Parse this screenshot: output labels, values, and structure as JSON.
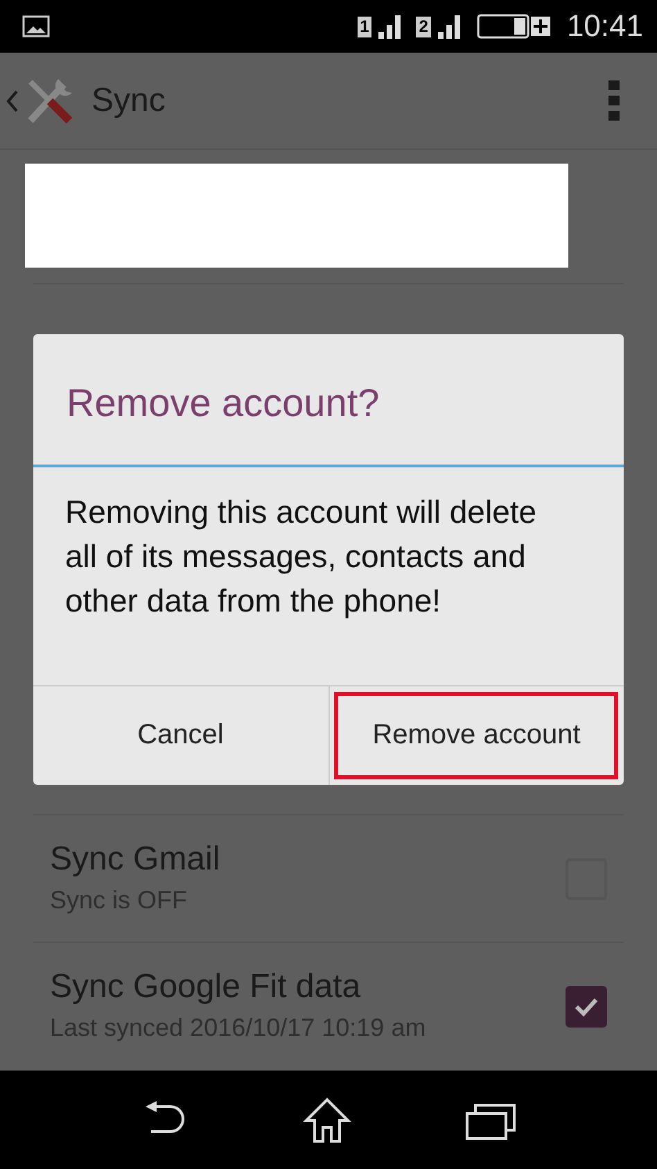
{
  "status_bar": {
    "time": "10:41",
    "sim_labels": [
      "1",
      "2"
    ]
  },
  "action_bar": {
    "title": "Sync"
  },
  "rows": [
    {
      "title": "Sync Gmail",
      "subtitle": "Sync is OFF",
      "checked": false
    },
    {
      "title": "Sync Google Fit data",
      "subtitle": "Last synced 2016/10/17 10:19 am",
      "checked": true
    }
  ],
  "dialog": {
    "title": "Remove account?",
    "message": "Removing this account will delete all of its messages, contacts and other data from the phone!",
    "buttons": [
      {
        "label": "Cancel",
        "highlighted": false
      },
      {
        "label": "Remove account",
        "highlighted": true
      }
    ]
  }
}
